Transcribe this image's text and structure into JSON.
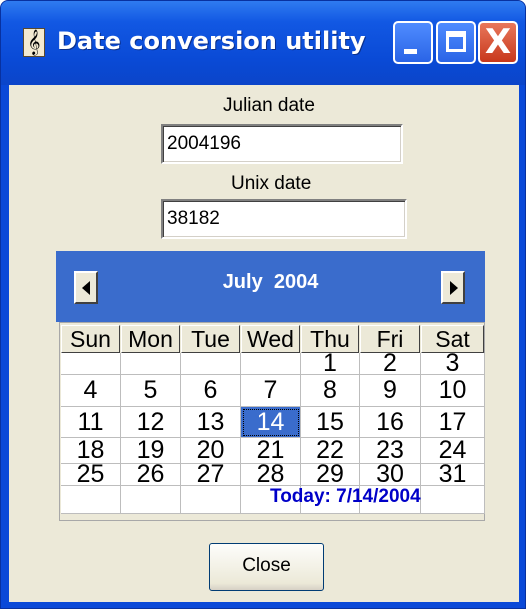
{
  "window": {
    "title": "Date conversion utility",
    "app_icon_glyph": "𝄞",
    "buttons": {
      "minimize": "minimize-icon",
      "maximize": "maximize-icon",
      "close": "close-icon",
      "close_glyph": "X"
    }
  },
  "form": {
    "julian_label": "Julian date",
    "julian_value": "2004196",
    "unix_label": "Unix date",
    "unix_value": "38182"
  },
  "calendar": {
    "month_title": "July  2004",
    "prev_icon": "left-arrow-icon",
    "next_icon": "right-arrow-icon",
    "weekdays": [
      "Sun",
      "Mon",
      "Tue",
      "Wed",
      "Thu",
      "Fri",
      "Sat"
    ],
    "weeks": [
      [
        "",
        "",
        "",
        "",
        "1",
        "2",
        "3"
      ],
      [
        "4",
        "5",
        "6",
        "7",
        "8",
        "9",
        "10"
      ],
      [
        "11",
        "12",
        "13",
        "14",
        "15",
        "16",
        "17"
      ],
      [
        "18",
        "19",
        "20",
        "21",
        "22",
        "23",
        "24"
      ],
      [
        "25",
        "26",
        "27",
        "28",
        "29",
        "30",
        "31"
      ],
      [
        "",
        "",
        "",
        "",
        "",
        "",
        ""
      ]
    ],
    "selected_day": "14",
    "today_text": "Today: 7/14/2004"
  },
  "close_button": "Close",
  "colors": {
    "accent": "#3a6ccc",
    "today_text": "#0000c8",
    "face": "#ece9d8"
  }
}
